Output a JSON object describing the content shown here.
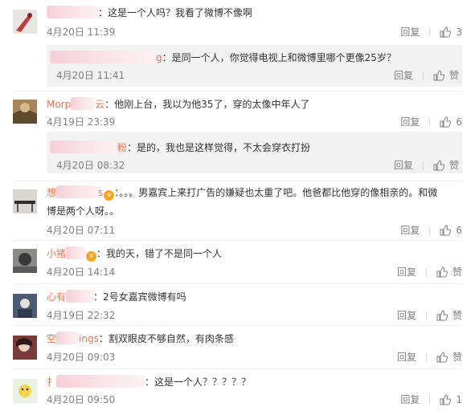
{
  "ui": {
    "reply_label": "回复",
    "like_label": "赞"
  },
  "comments": [
    {
      "name_suffix": "",
      "text": "：这是一个人吗？我看了微博不像啊",
      "time": "4月20日 11:39",
      "likes": "3"
    },
    {
      "name_suffix": "g",
      "text": "：是同一个人，你觉得电视上和微博里哪个更像25岁？",
      "time": "4月20日 11:41",
      "likes": "赞"
    },
    {
      "name_prefix": "Morp",
      "name_suffix": "云",
      "text": "：他刚上台，我以为他35了，穿的太像中年人了",
      "time": "4月19日 23:39",
      "likes": "6"
    },
    {
      "name_suffix": "粉",
      "text": "：是的，我也是这样觉得，不太会穿衣打扮",
      "time": "4月20日 08:32",
      "likes": "赞"
    },
    {
      "name_prefix": "想",
      "name_suffix": "s",
      "text_line1": "：。。。男嘉宾上来打广告的嫌疑也太重了吧。他爸都比他穿的像相亲的。和微",
      "text_line2": "博是两个人呀。。",
      "time": "4月20日 07:11",
      "likes": "6"
    },
    {
      "name_prefix": "小猪",
      "text": "：我的天，错了不是同一个人",
      "time": "4月20日 14:14",
      "likes": "赞"
    },
    {
      "name_prefix": "心有",
      "text": "：2号女嘉宾微博有吗",
      "time": "4月19日 22:32",
      "likes": "赞"
    },
    {
      "name_prefix": "空",
      "name_suffix": "ings",
      "text": "：割双眼皮不够自然，有肉条感",
      "time": "4月20日 09:03",
      "likes": "赞"
    },
    {
      "name_prefix": "扌",
      "text": "：这是一个人？？？？？",
      "time": "4月20日 09:50",
      "likes": "1"
    }
  ]
}
